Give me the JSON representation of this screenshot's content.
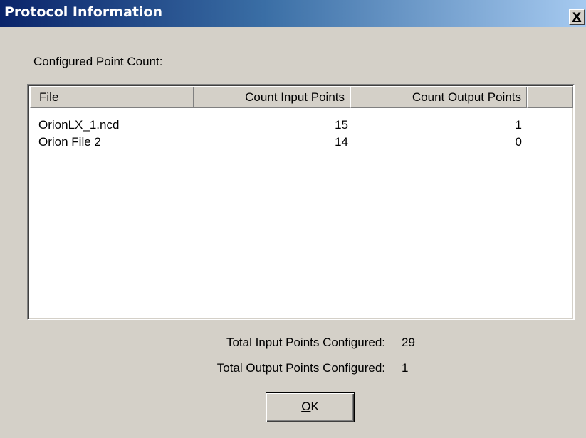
{
  "window": {
    "title": "Protocol Information",
    "close_glyph": "X"
  },
  "section_label": "Configured Point Count:",
  "table": {
    "columns": [
      "File",
      "Count Input Points",
      "Count Output Points"
    ],
    "rows": [
      [
        "OrionLX_1.ncd",
        "15",
        "1"
      ],
      [
        "Orion File 2",
        "14",
        "0"
      ]
    ]
  },
  "totals": {
    "input_label": "Total Input Points Configured:",
    "input_value": "29",
    "output_label": "Total Output Points Configured:",
    "output_value": "1"
  },
  "buttons": {
    "ok_mnemonic": "O",
    "ok_rest": "K"
  },
  "colors": {
    "dialog_face": "#d4d0c8",
    "titlebar_start": "#0a246a",
    "titlebar_end": "#a6caf0"
  }
}
